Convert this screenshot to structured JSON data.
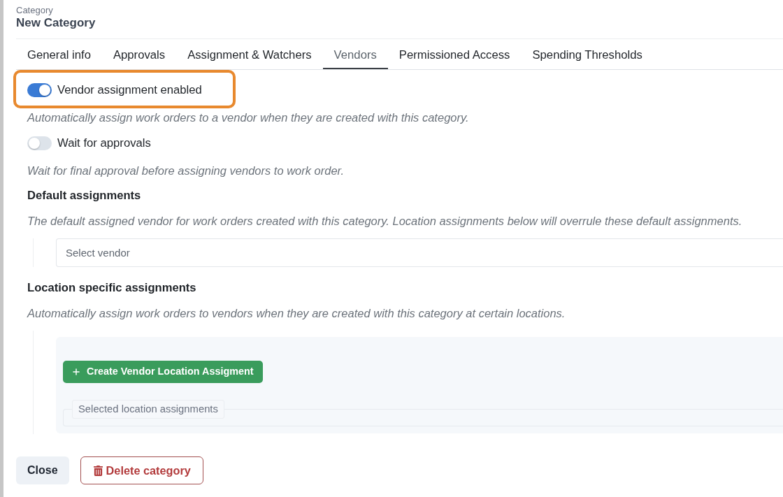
{
  "header": {
    "label": "Category",
    "title": "New Category"
  },
  "tabs": [
    {
      "label": "General info",
      "selected": false
    },
    {
      "label": "Approvals",
      "selected": false
    },
    {
      "label": "Assignment & Watchers",
      "selected": false
    },
    {
      "label": "Vendors",
      "selected": true
    },
    {
      "label": "Permissioned Access",
      "selected": false
    },
    {
      "label": "Spending Thresholds",
      "selected": false
    }
  ],
  "vendors": {
    "settings": [
      {
        "label": "Vendor assignment enabled",
        "on": true,
        "highlighted": true,
        "description": "Automatically assign work orders to a vendor when they are created with this category."
      },
      {
        "label": "Wait for approvals",
        "on": false,
        "highlighted": false,
        "description": "Wait for final approval before assigning vendors to work order."
      }
    ],
    "default_assignments": {
      "heading": "Default assignments",
      "description": "The default assigned vendor for work orders created with this category. Location assignments below will overrule these default assignments.",
      "vendor_select": {
        "placeholder": "Select vendor"
      }
    },
    "location_assignments": {
      "heading": "Location specific assignments",
      "description": "Automatically assign work orders to vendors when they are created with this category at certain locations.",
      "create_button": {
        "label": "Create Vendor Location Assigment"
      },
      "selected_group": {
        "legend": "Selected location assignments"
      }
    }
  },
  "footer": {
    "buttons": [
      {
        "label": "Close",
        "kind": "secondary"
      },
      {
        "label": "Delete category",
        "kind": "danger"
      }
    ]
  }
}
